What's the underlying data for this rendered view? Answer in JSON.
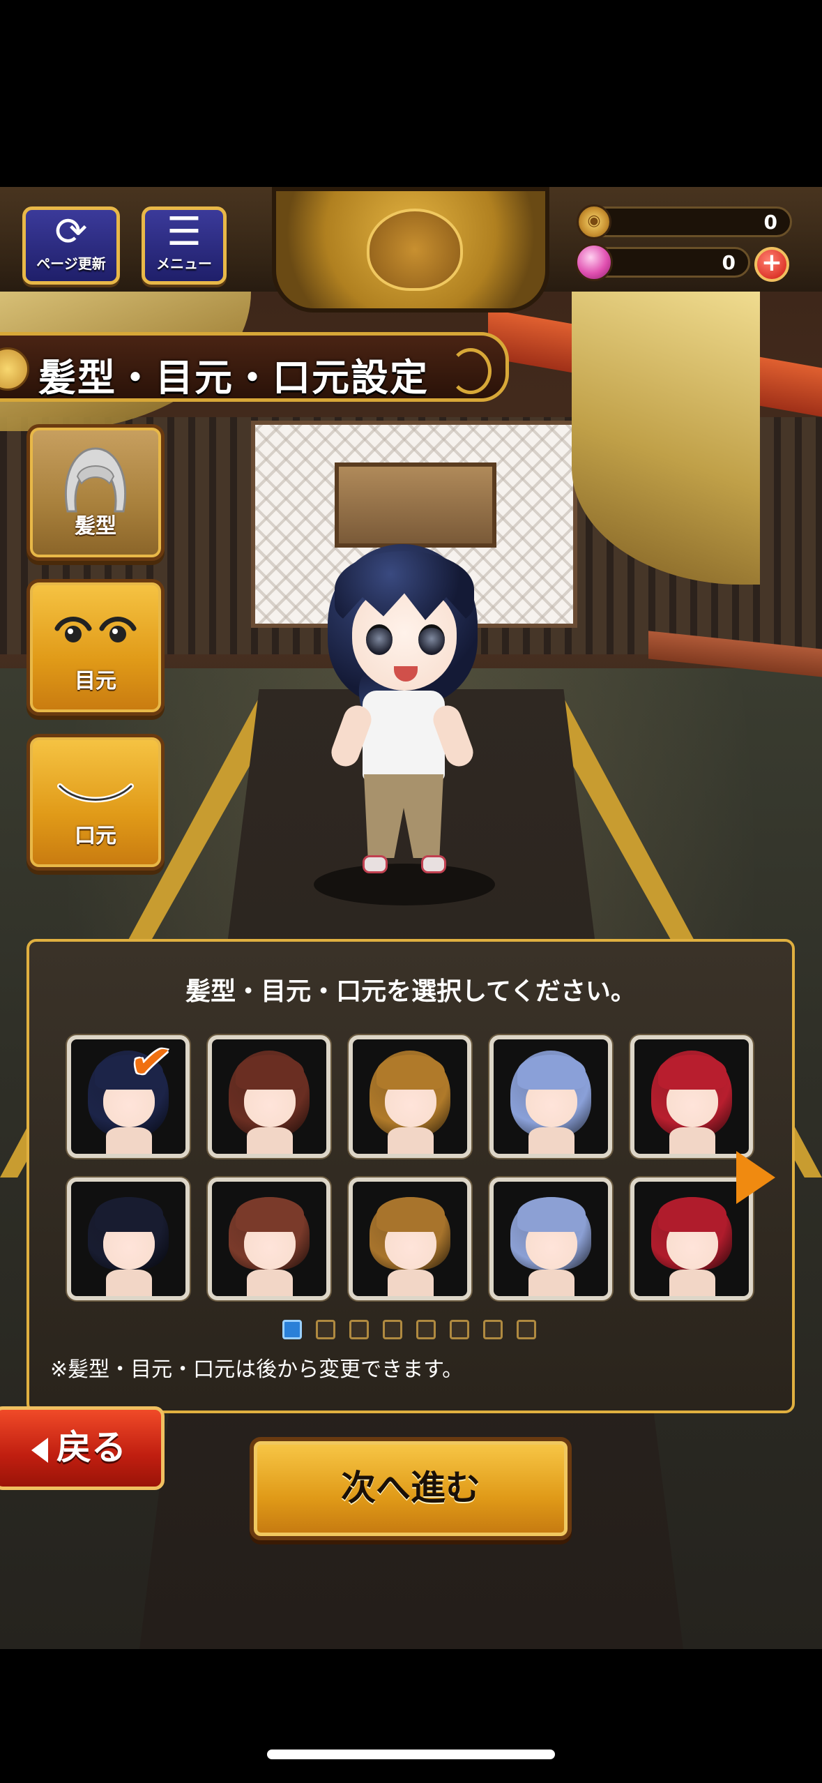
{
  "hud": {
    "reload_label": "ページ更新",
    "menu_label": "メニュー",
    "coins": "0",
    "gems": "0",
    "plus_label": "+"
  },
  "title": "髪型・目元・口元設定",
  "tabs": [
    {
      "label": "髪型",
      "icon": "hair-icon"
    },
    {
      "label": "目元",
      "icon": "eyes-icon"
    },
    {
      "label": "口元",
      "icon": "mouth-icon"
    }
  ],
  "panel": {
    "prompt": "髪型・目元・口元を選択してください。",
    "note": "※髪型・目元・口元は後から変更できます。",
    "hair_options": [
      {
        "color": "#1c2448",
        "style": "long",
        "selected": true
      },
      {
        "color": "#6a2e22",
        "style": "long",
        "selected": false
      },
      {
        "color": "#b07a2a",
        "style": "long",
        "selected": false
      },
      {
        "color": "#8aa0d8",
        "style": "long",
        "selected": false
      },
      {
        "color": "#b81e2e",
        "style": "long",
        "selected": false
      },
      {
        "color": "#181c30",
        "style": "short",
        "selected": false
      },
      {
        "color": "#7a3a2a",
        "style": "short",
        "selected": false
      },
      {
        "color": "#a8742c",
        "style": "short",
        "selected": false
      },
      {
        "color": "#8ca0d4",
        "style": "short",
        "selected": false
      },
      {
        "color": "#b01c2c",
        "style": "short",
        "selected": false
      }
    ],
    "page_current": 1,
    "page_total": 8
  },
  "buttons": {
    "back_label": "戻る",
    "next_label": "次へ進む"
  }
}
